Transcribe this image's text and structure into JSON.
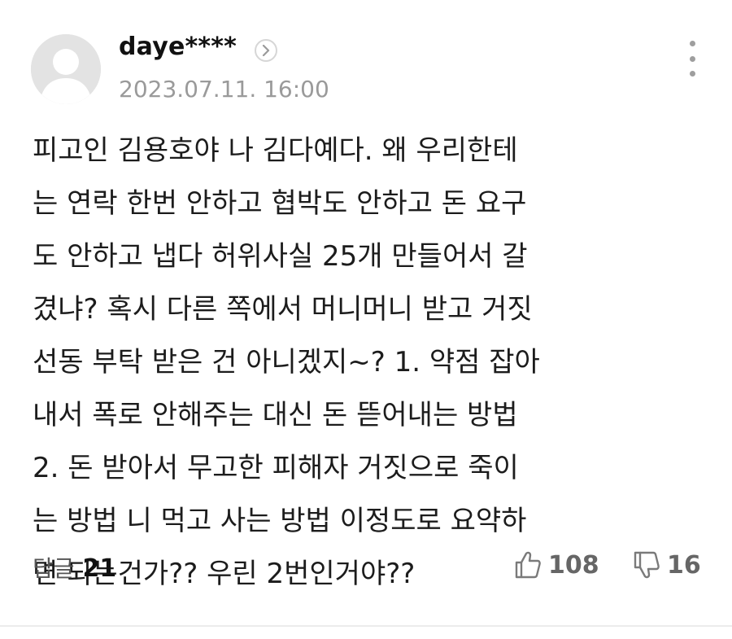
{
  "comment": {
    "username": "daye****",
    "timestamp": "2023.07.11. 16:00",
    "body_lines": [
      "피고인 김용호야 나 김다예다. 왜 우리한테",
      "는 연락 한번 안하고 협박도 안하고 돈 요구",
      "도 안하고 냅다 허위사실 25개 만들어서 갈",
      "겼냐? 혹시 다른 쪽에서 머니머니 받고 거짓",
      "선동 부탁 받은 건 아니겠지~? 1. 약점 잡아",
      "내서 폭로 안해주는 대신 돈 뜯어내는 방법",
      "2. 돈 받아서 무고한 피해자 거짓으로 죽이",
      "는 방법 니 먹고 사는 방법 이정도로 요약하",
      "면 되는건가?? 우린 2번인거야??"
    ],
    "reply_label": "답글",
    "reply_count": "21",
    "like_count": "108",
    "dislike_count": "16"
  },
  "icons": {
    "avatar": "default-user-avatar",
    "profile_link": "chevron-right-icon",
    "more": "more-vertical-icon",
    "like": "thumbs-up-icon",
    "dislike": "thumbs-down-icon"
  },
  "colors": {
    "text": "#1c1c1c",
    "muted": "#9a9a9a",
    "avatar_bg": "#e3e3e3"
  }
}
